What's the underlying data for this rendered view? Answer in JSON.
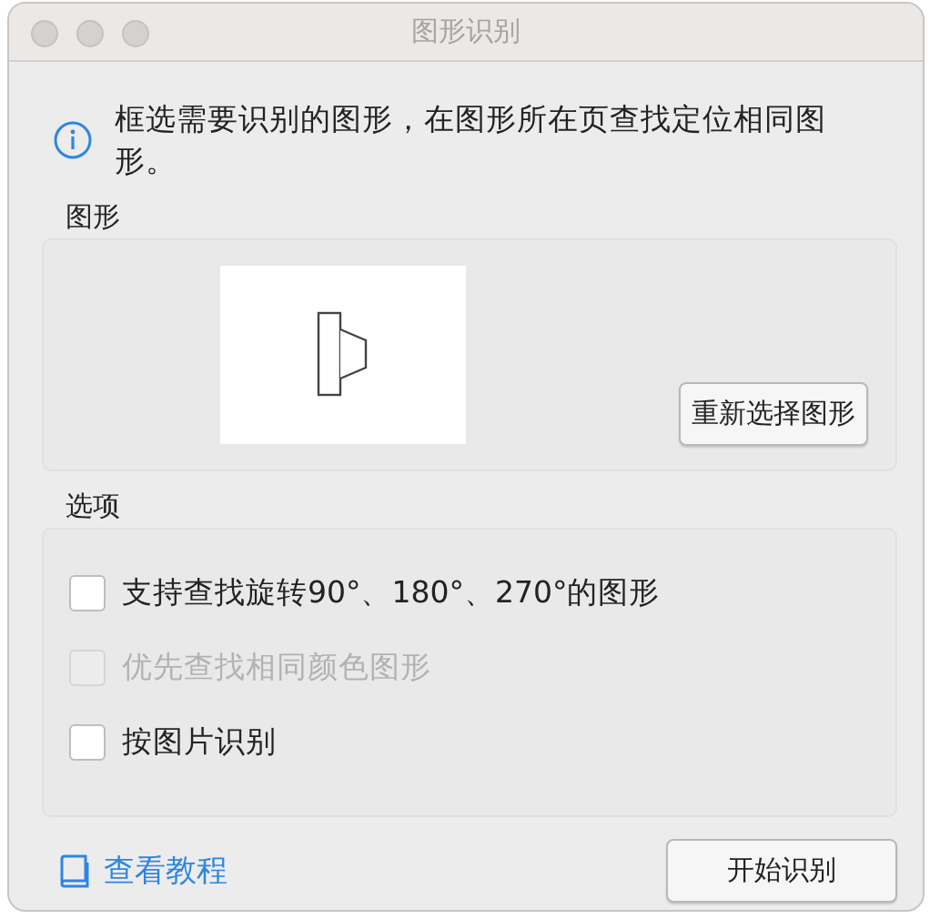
{
  "window": {
    "title": "图形识别"
  },
  "info": "框选需要识别的图形，在图形所在页查找定位相同图形。",
  "shape_group": {
    "label": "图形",
    "button": "重新选择图形"
  },
  "options_group": {
    "label": "选项",
    "options": [
      {
        "label": "支持查找旋转90°、180°、270°的图形",
        "checked": false,
        "disabled": false
      },
      {
        "label": "优先查找相同颜色图形",
        "checked": false,
        "disabled": true
      },
      {
        "label": "按图片识别",
        "checked": false,
        "disabled": false
      }
    ]
  },
  "tutorial_link": "查看教程",
  "start_button": "开始识别"
}
